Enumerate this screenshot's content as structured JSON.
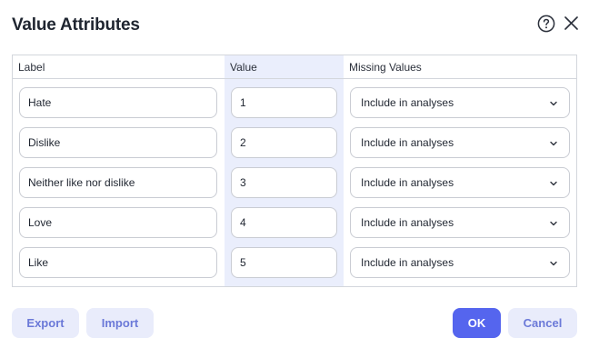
{
  "dialog": {
    "title": "Value Attributes"
  },
  "table": {
    "headers": {
      "label": "Label",
      "value": "Value",
      "missing": "Missing Values"
    },
    "rows": [
      {
        "label": "Hate",
        "value": "1",
        "missing": "Include in analyses"
      },
      {
        "label": "Dislike",
        "value": "2",
        "missing": "Include in analyses"
      },
      {
        "label": "Neither like nor dislike",
        "value": "3",
        "missing": "Include in analyses"
      },
      {
        "label": "Love",
        "value": "4",
        "missing": "Include in analyses"
      },
      {
        "label": "Like",
        "value": "5",
        "missing": "Include in analyses"
      }
    ]
  },
  "footer": {
    "export_label": "Export",
    "import_label": "Import",
    "ok_label": "OK",
    "cancel_label": "Cancel"
  },
  "colors": {
    "primary": "#5565ee",
    "secondary_bg": "#e9ecfb",
    "secondary_text": "#6b79d8",
    "value_column_bg": "#eaeefc"
  },
  "icons": {
    "help": "help-circle-icon",
    "close": "close-icon",
    "dropdown": "chevron-down-icon"
  }
}
